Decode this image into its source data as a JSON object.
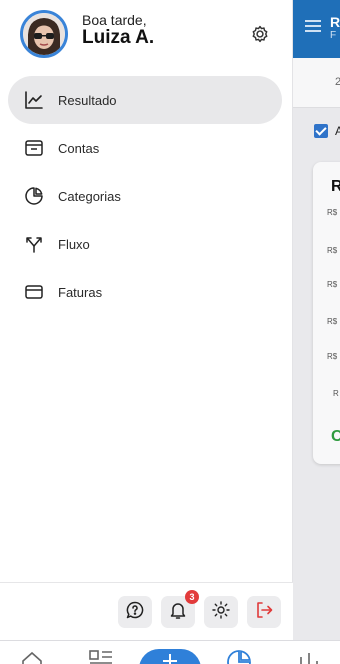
{
  "profile": {
    "greeting": "Boa tarde,",
    "name": "Luiza A."
  },
  "menu": {
    "items": [
      {
        "label": "Resultado",
        "icon": "line-chart-icon",
        "active": true
      },
      {
        "label": "Contas",
        "icon": "wallet-icon",
        "active": false
      },
      {
        "label": "Categorias",
        "icon": "pie-chart-icon",
        "active": false
      },
      {
        "label": "Fluxo",
        "icon": "split-arrows-icon",
        "active": false
      },
      {
        "label": "Faturas",
        "icon": "credit-card-icon",
        "active": false
      }
    ]
  },
  "footer": {
    "notifications_count": "3",
    "buttons": [
      "help-chat-icon",
      "bell-icon",
      "sun-icon",
      "logout-icon"
    ]
  },
  "background": {
    "header_title": "R",
    "header_sub": "F",
    "tab_fragment": "2",
    "checkbox_label": "A",
    "card_title": "R",
    "card_rows": [
      "R$",
      "R$",
      "R$",
      "R$",
      "R$",
      "R"
    ],
    "card_highlight": "C"
  },
  "colors": {
    "accent": "#2f80d9",
    "avatar_ring": "#3a84d8",
    "badge": "#e23b3b",
    "logout": "#e03a3a",
    "header": "#1f6fb8"
  }
}
